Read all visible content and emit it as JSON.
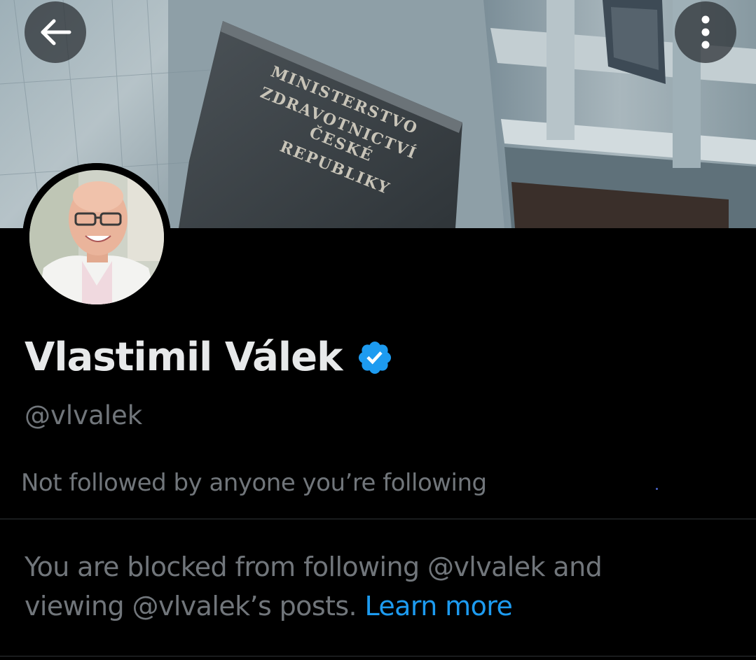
{
  "header": {
    "back_icon": "arrow-left-icon",
    "more_icon": "more-vertical-icon"
  },
  "banner": {
    "sign_lines": [
      "MINISTERSTVO",
      "ZDRAVOTNICTVÍ",
      "ČESKÉ",
      "REPUBLIKY"
    ]
  },
  "profile": {
    "display_name": "Vlastimil Válek",
    "verified_icon": "verified-badge-icon",
    "handle": "@vlvalek",
    "followed_by": "Not followed by anyone you’re following"
  },
  "blocked": {
    "line1": "You are blocked from following @vlvalek and",
    "line2": "viewing @vlvalek’s posts.",
    "learn_more": "Learn more"
  },
  "colors": {
    "background": "#000000",
    "primary_text": "#e7e9ea",
    "secondary_text": "#71767b",
    "accent": "#1d9bf0",
    "divider": "#2f3336"
  }
}
